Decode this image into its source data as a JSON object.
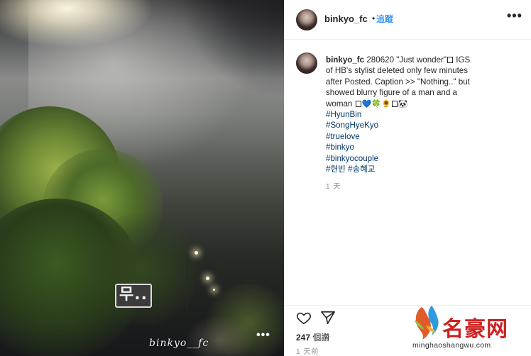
{
  "photo": {
    "sticker_text": "무..",
    "watermark": "binkyo__fc",
    "more_icon": "more-dots-icon",
    "more_label": "•••"
  },
  "header": {
    "username": "binkyo_fc",
    "separator": "•",
    "follow_label": "追蹤",
    "more_label": "•••"
  },
  "caption": {
    "username": "binkyo_fc",
    "line1": "280620 \"Just wonder\"",
    "line1_tail": " IGS",
    "line2": "of HB's stylist deleted only few minutes",
    "line3": "after Posted. Caption >> \"Nothing..\" but",
    "line4": "showed blurry figure of a man and a",
    "line5": "woman",
    "emojis": [
      "💙",
      "🍀",
      "🌻",
      "🐼"
    ],
    "hashtags": [
      "#HyunBin",
      "#SongHyeKyo",
      "#truelove",
      "#binkyo",
      "#binkyocouple",
      "#현빈 #송혜교"
    ],
    "time": "1 天"
  },
  "actions": {
    "heart_icon": "heart-icon",
    "send_icon": "send-icon",
    "likes_count": "247",
    "likes_label": " 個讚",
    "posted_ago": "1 天前"
  },
  "site_logo": {
    "brand": "名豪网",
    "domain": "minghaoshangwu.com",
    "colors": {
      "brand": "#cc2222",
      "link": "#003569",
      "follow": "#3897f0"
    }
  }
}
